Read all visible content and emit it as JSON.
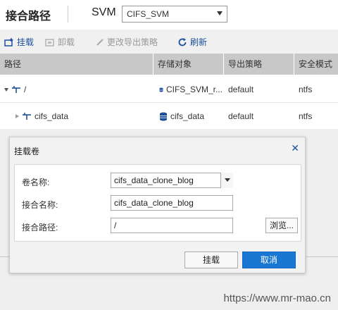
{
  "header": {
    "title": "接合路径",
    "svm_label": "SVM",
    "svm_value": "CIFS_SVM"
  },
  "toolbar": {
    "mount_label": "挂载",
    "unmount_label": "卸载",
    "change_policy_label": "更改导出策略",
    "refresh_label": "刷新"
  },
  "table": {
    "columns": [
      "路径",
      "存储对象",
      "导出策略",
      "安全模式"
    ],
    "rows": [
      {
        "path": "/",
        "storage_object": "CIFS_SVM_r...",
        "export_policy": "default",
        "security_style": "ntfs"
      },
      {
        "path": "cifs_data",
        "storage_object": "cifs_data",
        "export_policy": "default",
        "security_style": "ntfs"
      }
    ]
  },
  "dialog": {
    "title": "挂载卷",
    "volume_name_label": "卷名称:",
    "volume_name_value": "cifs_data_clone_blog",
    "junction_name_label": "接合名称:",
    "junction_name_value": "cifs_data_clone_blog",
    "junction_path_label": "接合路径:",
    "junction_path_value": "/",
    "browse_label": "浏览...",
    "mount_button": "挂载",
    "cancel_button": "取消"
  },
  "watermark": "https://www.mr-mao.cn",
  "colors": {
    "accent": "#1877d2",
    "link": "#1a4f9c",
    "table_header": "#c8c8c8"
  }
}
